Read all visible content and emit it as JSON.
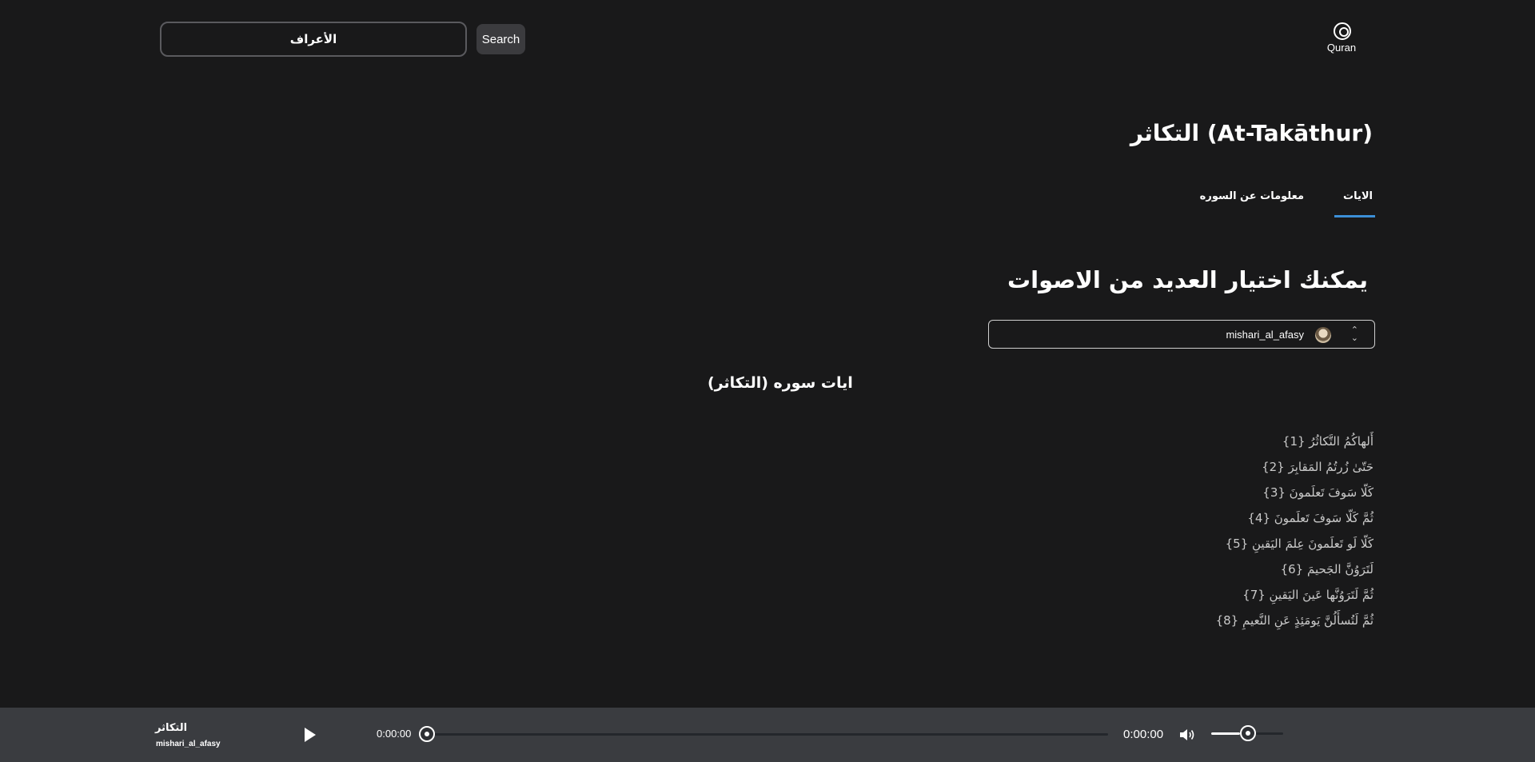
{
  "header": {
    "search_value": "الأعراف",
    "search_button_label": "Search",
    "logo_text": "Quran"
  },
  "surah": {
    "title": "التكاثر (At-Takāthur)"
  },
  "tabs": [
    {
      "label": "الايات",
      "active": true
    },
    {
      "label": "معلومات عن السوره",
      "active": false
    }
  ],
  "voices": {
    "heading": "يمكنك اختيار العديد من الاصوات",
    "selected_reciter": "mishari_al_afasy"
  },
  "ayat_section": {
    "heading": "ايات سوره (التكاثر)",
    "verses": [
      "أَلهاكُمُ التَّكاثُرُ {1}",
      "حَتّىٰ زُرتُمُ المَقابِرَ {2}",
      "كَلّا سَوفَ تَعلَمونَ {3}",
      "ثُمَّ كَلّا سَوفَ تَعلَمونَ {4}",
      "كَلّا لَو تَعلَمونَ عِلمَ اليَقينِ {5}",
      "لَتَرَوُنَّ الجَحيمَ {6}",
      "ثُمَّ لَتَرَوُنَّها عَينَ اليَقينِ {7}",
      "ثُمَّ لَتُسأَلُنَّ يَومَئِذٍ عَنِ النَّعيمِ {8}"
    ]
  },
  "player": {
    "track_title": "التكاثر",
    "track_artist": "mishari_al_afasy",
    "current_time": "0:00:00",
    "total_time": "0:00:00",
    "progress": 0,
    "volume": 0.4
  },
  "colors": {
    "background": "#19191a",
    "player_bar": "#3a3c40",
    "accent": "#3c8fd7"
  }
}
